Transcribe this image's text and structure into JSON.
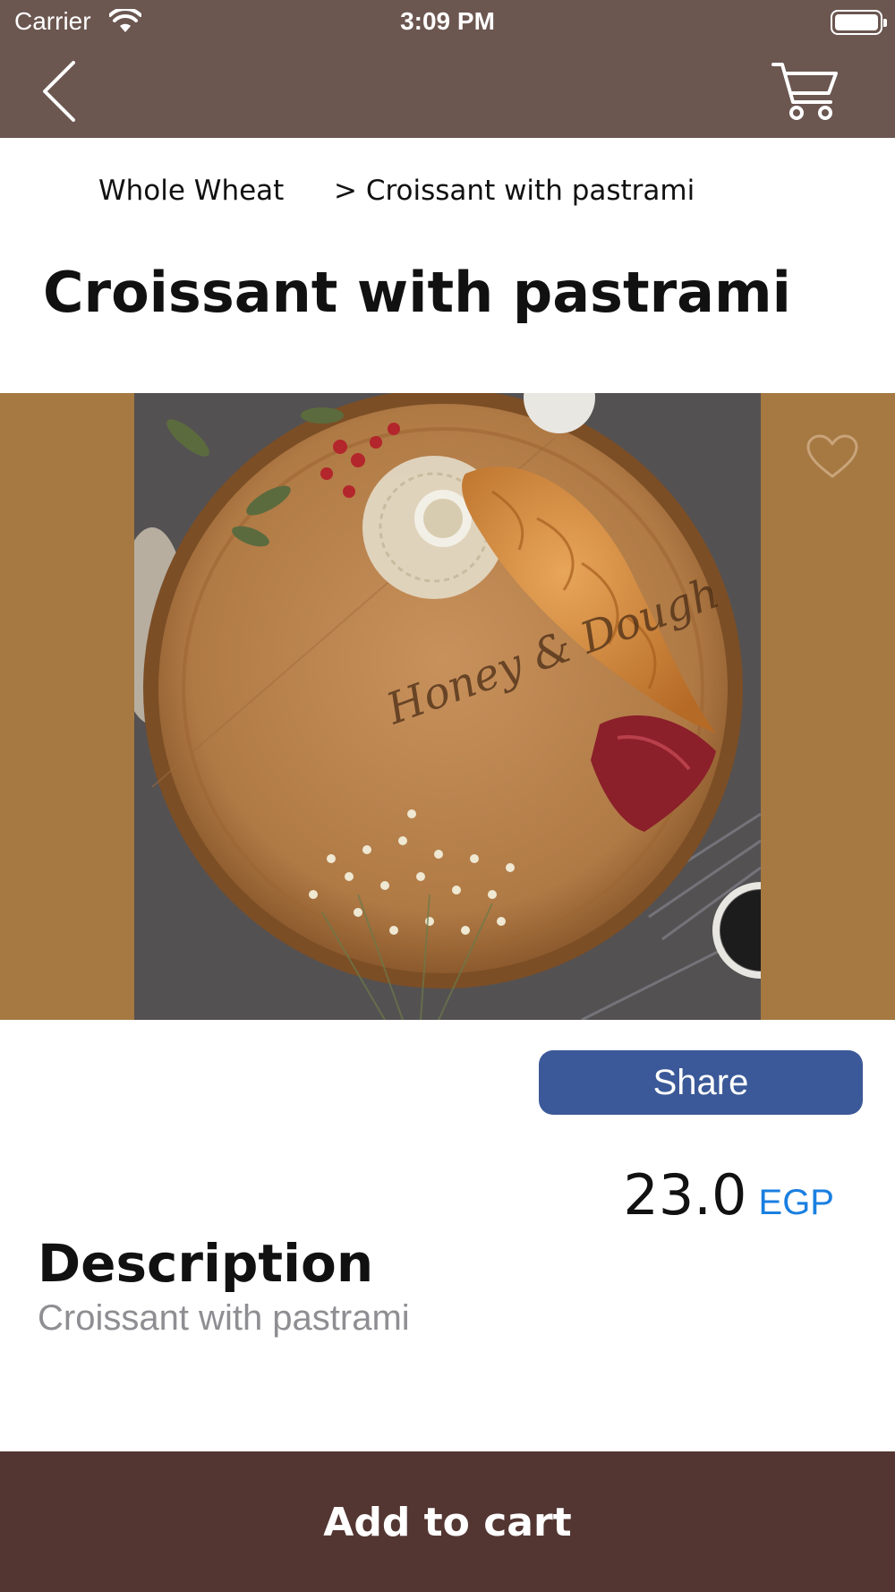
{
  "status_bar": {
    "carrier": "Carrier",
    "time": "3:09 PM"
  },
  "nav": {
    "back_icon": "chevron-left-icon",
    "cart_icon": "shopping-cart-icon",
    "color": "#6b5650"
  },
  "breadcrumb": {
    "category": "Whole Wheat",
    "current": "> Croissant with pastrami"
  },
  "product": {
    "title": "Croissant with pastrami",
    "image_background": "#a57941",
    "favorite_icon": "heart-outline-icon",
    "image_logo_text": "Honey & Dough",
    "share_label": "Share",
    "price": "23.0",
    "currency": "EGP",
    "description_heading": "Description",
    "description": "Croissant with pastrami"
  },
  "footer": {
    "add_to_cart_label": "Add to cart",
    "color": "#533632"
  },
  "colors": {
    "share": "#3b5998",
    "currency": "#1a7fe0",
    "muted_text": "#8e8e93"
  }
}
